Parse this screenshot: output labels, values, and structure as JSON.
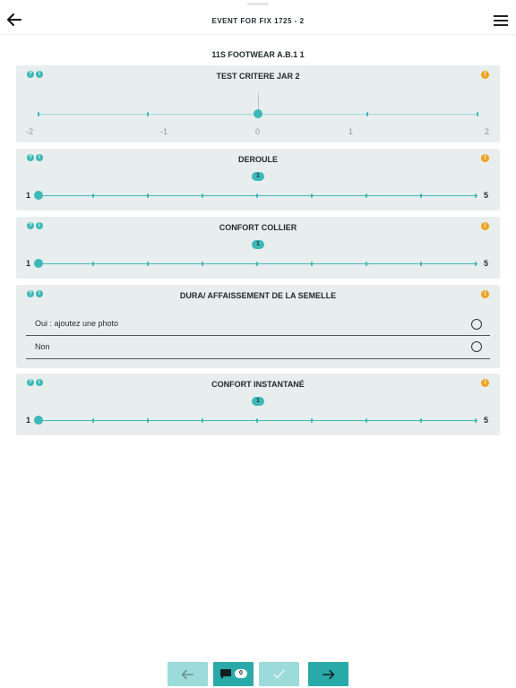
{
  "header": {
    "title": "EVENT FOR FIX 1725 - 2",
    "back_icon": "arrow-left-icon",
    "menu_icon": "hamburger-menu-icon"
  },
  "subtitle": "11S FOOTWEAR A.B.1 1",
  "colors": {
    "accent": "#3eb8b8",
    "warning": "#f0a11f",
    "card_bg": "#e8eeed",
    "accent_light": "#9ddada",
    "accent_dark": "#2aa9a9"
  },
  "criteria": [
    {
      "title": "TEST CRITERE JAR 2",
      "type": "jar-scale",
      "labels": [
        "-2",
        "-1",
        "0",
        "1",
        "2"
      ],
      "value": 0
    },
    {
      "title": "DEROULE",
      "type": "scale",
      "min_label": "1",
      "max_label": "5",
      "value": "1"
    },
    {
      "title": "CONFORT COLLIER",
      "type": "scale",
      "min_label": "1",
      "max_label": "5",
      "value": "1"
    },
    {
      "title": "DURA/ AFFAISSEMENT DE LA SEMELLE",
      "type": "choice",
      "options": [
        "Oui : ajoutez une photo",
        "Non"
      ],
      "selected": null
    },
    {
      "title": "CONFORT INSTANTANÉ",
      "type": "scale",
      "min_label": "1",
      "max_label": "5",
      "value": "1"
    }
  ],
  "footer": {
    "comment_count": "0",
    "buttons": [
      "arrow-left-icon",
      "comment-icon",
      "check-icon",
      "arrow-right-icon"
    ]
  }
}
